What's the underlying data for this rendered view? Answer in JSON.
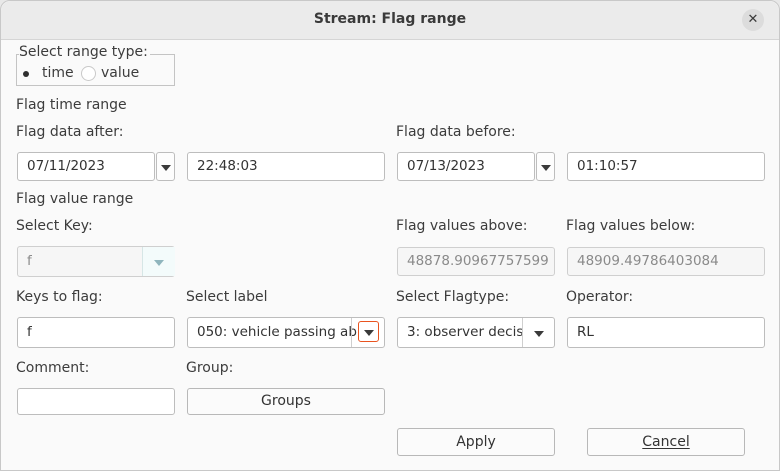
{
  "window": {
    "title": "Stream: Flag range",
    "close_glyph": "✕"
  },
  "range_type": {
    "legend": "Select range type:",
    "options": [
      {
        "label": "time",
        "selected": true
      },
      {
        "label": "value",
        "selected": false
      }
    ]
  },
  "time_section": {
    "heading": "Flag time range",
    "after_label": "Flag data after:",
    "after_date": "07/11/2023",
    "after_time": "22:48:03",
    "before_label": "Flag data before:",
    "before_date": "07/13/2023",
    "before_time": "01:10:57"
  },
  "value_section": {
    "heading": "Flag value range",
    "key_label": "Select Key:",
    "key_value": "f",
    "above_label": "Flag values above:",
    "above_value": "48878.90967757599",
    "below_label": "Flag values below:",
    "below_value": "48909.49786403084"
  },
  "flag_section": {
    "keys_label": "Keys to flag:",
    "keys_value": "f",
    "select_label_label": "Select label",
    "select_label_value": "050: vehicle passing ab",
    "flagtype_label": "Select Flagtype:",
    "flagtype_value": "3: observer decis",
    "operator_label": "Operator:",
    "operator_value": "RL"
  },
  "misc": {
    "comment_label": "Comment:",
    "comment_value": "",
    "group_label": "Group:",
    "groups_button": "Groups"
  },
  "buttons": {
    "apply": "Apply",
    "cancel": "Cancel"
  },
  "colors": {
    "accent_orange": "#e95420",
    "disabled_dropdown_bg": "#f3fbfb"
  }
}
